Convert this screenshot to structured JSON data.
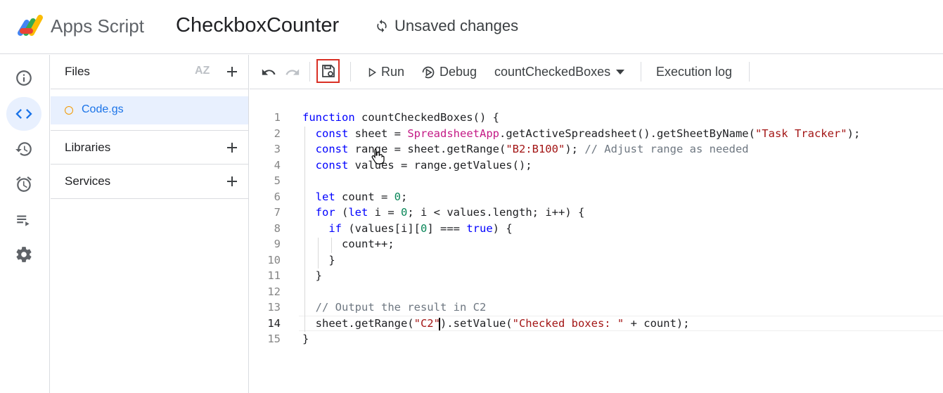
{
  "header": {
    "app_name": "Apps Script",
    "project_name": "CheckboxCounter",
    "status": "Unsaved changes"
  },
  "sidebar": {
    "icons": [
      "info-icon",
      "code-editor-icon",
      "history-icon",
      "triggers-alarm-icon",
      "executions-icon",
      "settings-gear-icon"
    ],
    "active": "code-editor-icon"
  },
  "files_panel": {
    "files_label": "Files",
    "sort_label": "AZ",
    "files": [
      {
        "name": "Code.gs"
      }
    ],
    "libraries_label": "Libraries",
    "services_label": "Services"
  },
  "toolbar": {
    "run_label": "Run",
    "debug_label": "Debug",
    "function_select": "countCheckedBoxes",
    "execution_log_label": "Execution log"
  },
  "editor": {
    "current_line": 14,
    "lines": [
      "function countCheckedBoxes() {",
      "  const sheet = SpreadsheetApp.getActiveSpreadsheet().getSheetByName(\"Task Tracker\");",
      "  const range = sheet.getRange(\"B2:B100\"); // Adjust range as needed",
      "  const values = range.getValues();",
      "",
      "  let count = 0;",
      "  for (let i = 0; i < values.length; i++) {",
      "    if (values[i][0] === true) {",
      "      count++;",
      "    }",
      "  }",
      "",
      "  // Output the result in C2",
      "  sheet.getRange(\"C2\").setValue(\"Checked boxes: \" + count);",
      "}"
    ]
  },
  "colors": {
    "keyword": "#0000ff",
    "string": "#a31515",
    "number": "#098658",
    "comment": "#6e7781",
    "class": "#c41a86",
    "accent": "#1a73e8",
    "highlight": "#d93025"
  }
}
